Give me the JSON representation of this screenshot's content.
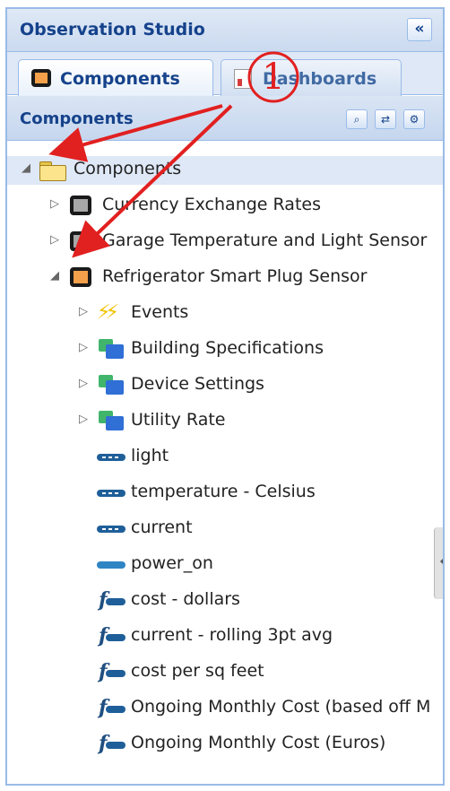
{
  "window": {
    "title": "Observation Studio"
  },
  "tabs": [
    {
      "label": "Components",
      "active": true
    },
    {
      "label": "Dashboards",
      "active": false
    }
  ],
  "components_panel": {
    "title": "Components",
    "toolbar": [
      "binoculars-icon",
      "refresh-icon",
      "settings-icon"
    ]
  },
  "tree": {
    "root": {
      "label": "Components",
      "expanded": true
    },
    "items": [
      {
        "label": "Currency Exchange Rates",
        "icon": "component-icon",
        "expanded": false
      },
      {
        "label": "Garage Temperature and Light Sensor",
        "icon": "component-icon",
        "expanded": false
      },
      {
        "label": "Refrigerator Smart Plug Sensor",
        "icon": "component-icon",
        "expanded": true
      }
    ],
    "children": [
      {
        "label": "Events",
        "icon": "events-icon",
        "expandable": true
      },
      {
        "label": "Building Specifications",
        "icon": "group-icon",
        "expandable": true
      },
      {
        "label": "Device Settings",
        "icon": "group-icon",
        "expandable": true
      },
      {
        "label": "Utility Rate",
        "icon": "group-icon",
        "expandable": true
      },
      {
        "label": "light",
        "icon": "variable-icon",
        "expandable": false
      },
      {
        "label": "temperature - Celsius",
        "icon": "variable-icon",
        "expandable": false
      },
      {
        "label": "current",
        "icon": "variable-icon",
        "expandable": false
      },
      {
        "label": "power_on",
        "icon": "boolean-variable-icon",
        "expandable": false
      },
      {
        "label": "cost - dollars",
        "icon": "function-icon",
        "expandable": false
      },
      {
        "label": "current - rolling 3pt avg",
        "icon": "function-icon",
        "expandable": false
      },
      {
        "label": "cost per sq feet",
        "icon": "function-icon",
        "expandable": false
      },
      {
        "label": "Ongoing Monthly Cost (based off M",
        "icon": "function-icon",
        "expandable": false
      },
      {
        "label": "Ongoing Monthly Cost (Euros)",
        "icon": "function-icon",
        "expandable": false
      }
    ]
  },
  "annotation": {
    "number": "1",
    "color": "#e12020"
  },
  "colors": {
    "header_text": "#15428b",
    "border": "#99bbe8",
    "annotation": "#e12020"
  }
}
